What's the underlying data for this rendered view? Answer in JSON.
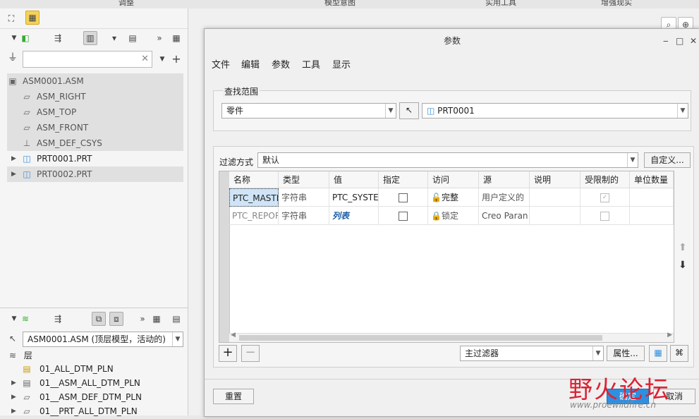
{
  "topbar": {
    "tabs": [
      "调整",
      "模型意图",
      "实用工具",
      "增强现实"
    ]
  },
  "model_tree": {
    "filter_placeholder": "",
    "items": [
      {
        "label": "ASM0001.ASM",
        "icon": "assembly-icon",
        "selected": true
      },
      {
        "label": "ASM_RIGHT",
        "icon": "datum-plane-icon"
      },
      {
        "label": "ASM_TOP",
        "icon": "datum-plane-icon"
      },
      {
        "label": "ASM_FRONT",
        "icon": "datum-plane-icon"
      },
      {
        "label": "ASM_DEF_CSYS",
        "icon": "csys-icon"
      },
      {
        "label": "PRT0001.PRT",
        "icon": "part-icon"
      },
      {
        "label": "PRT0002.PRT",
        "icon": "part-icon",
        "selected": true
      }
    ]
  },
  "layer_tree": {
    "model_select": "ASM0001.ASM (顶层模型，活动的)",
    "header": "层",
    "items": [
      "01_ALL_DTM_PLN",
      "01__ASM_ALL_DTM_PLN",
      "01__ASM_DEF_DTM_PLN",
      "01__PRT_ALL_DTM_PLN"
    ]
  },
  "dialog": {
    "title": "参数",
    "menu": [
      "文件",
      "编辑",
      "参数",
      "工具",
      "显示"
    ],
    "scope_legend": "查找范围",
    "scope_type": "零件",
    "scope_object": "PRT0001",
    "filter_label": "过滤方式",
    "filter_value": "默认",
    "customize_button": "自定义...",
    "columns": [
      "名称",
      "类型",
      "值",
      "指定",
      "访问",
      "源",
      "说明",
      "受限制的",
      "单位数量"
    ],
    "rows": [
      {
        "name": "PTC_MASTE",
        "type": "字符串",
        "value": "PTC_SYSTE",
        "access": "完整",
        "source": "用户定义的"
      },
      {
        "name": "PTC_REPOR",
        "type": "字符串",
        "value": "列表",
        "access": "锁定",
        "source": "Creo Paran"
      }
    ],
    "bottom_filter": "主过滤器",
    "properties_button": "属性...",
    "reset_button": "重置",
    "ok_button": "确定",
    "cancel_button": "取消"
  },
  "watermark": {
    "text": "野火论坛",
    "url": "www.proewildfire.cn"
  }
}
